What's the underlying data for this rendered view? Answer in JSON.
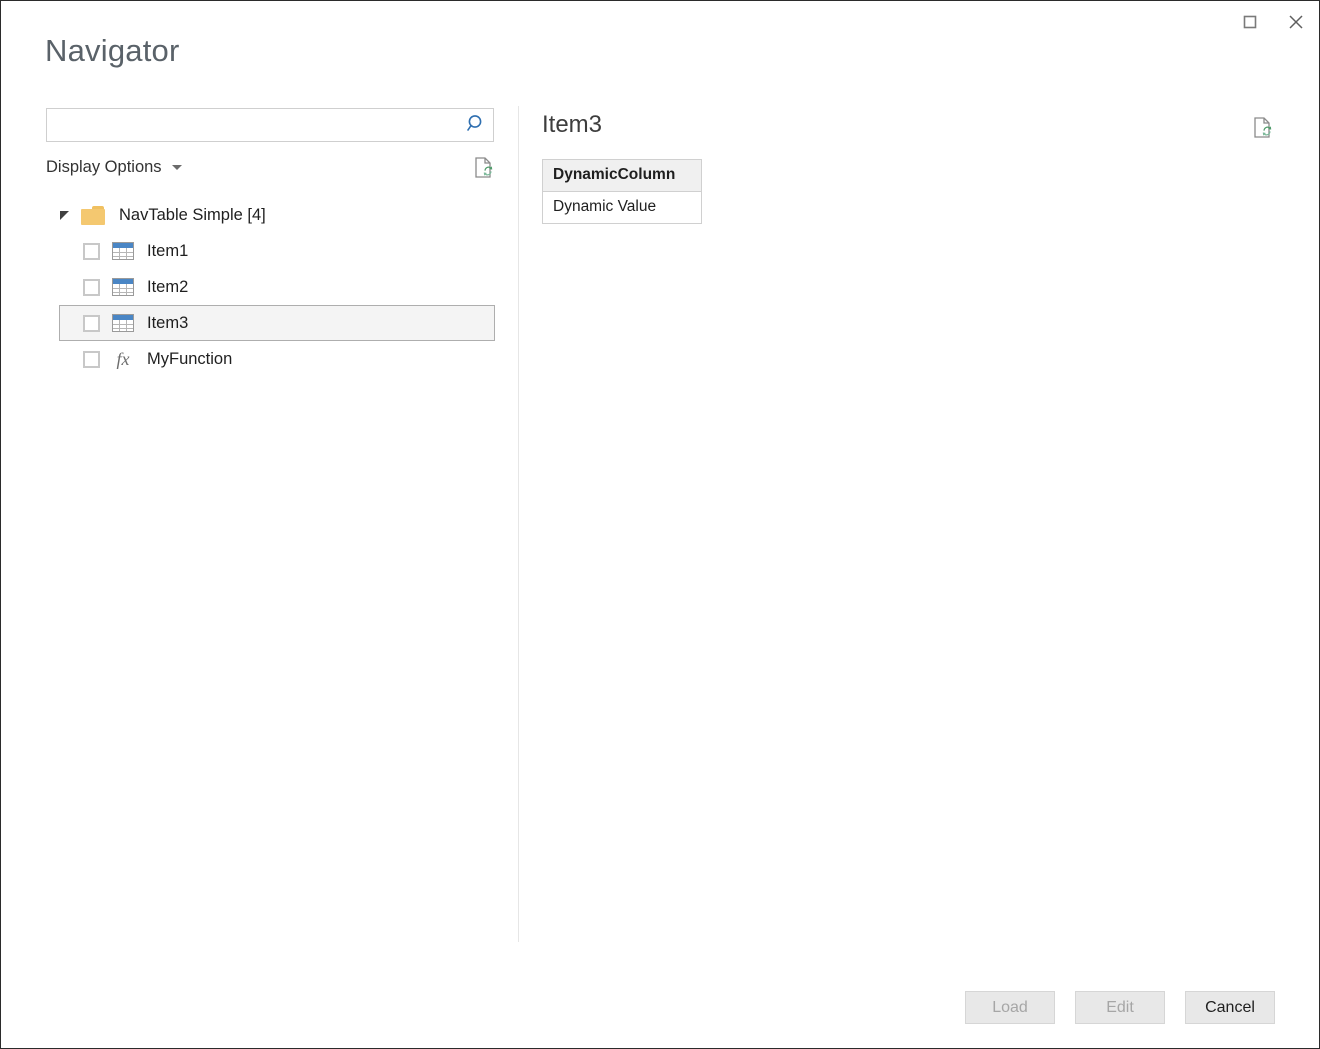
{
  "window": {
    "title": "Navigator",
    "controls": [
      {
        "name": "maximize-button",
        "icon": "maximize-icon",
        "label": ""
      },
      {
        "name": "close-button",
        "icon": "close-icon",
        "label": ""
      }
    ]
  },
  "left_pane": {
    "search": {
      "value": "",
      "placeholder": "",
      "icon": "search-icon"
    },
    "display_options": {
      "label": "Display Options",
      "caret_icon": "chevron-down-icon"
    },
    "refresh": {
      "icon": "refresh-document-icon",
      "tooltip": "Refresh"
    },
    "tree": {
      "root": {
        "label": "NavTable Simple [4]",
        "icon": "folder-icon",
        "expanded": true,
        "twisty_icon": "triangle-expanded-icon"
      },
      "items": [
        {
          "label": "Item1",
          "icon": "table-icon",
          "checked": false,
          "selected": false
        },
        {
          "label": "Item2",
          "icon": "table-icon",
          "checked": false,
          "selected": false
        },
        {
          "label": "Item3",
          "icon": "table-icon",
          "checked": false,
          "selected": true
        },
        {
          "label": "MyFunction",
          "icon": "fx-icon",
          "checked": false,
          "selected": false
        }
      ]
    }
  },
  "preview": {
    "title": "Item3",
    "refresh": {
      "icon": "refresh-document-icon",
      "tooltip": "Refresh"
    },
    "table": {
      "columns": [
        "DynamicColumn"
      ],
      "rows": [
        [
          "Dynamic Value"
        ]
      ]
    }
  },
  "footer": {
    "buttons": [
      {
        "name": "load-button",
        "label": "Load",
        "disabled": true
      },
      {
        "name": "edit-button",
        "label": "Edit",
        "disabled": true
      },
      {
        "name": "cancel-button",
        "label": "Cancel",
        "disabled": false
      }
    ]
  },
  "colors": {
    "title_text": "#5a6269",
    "accent_blue": "#2f6fb0",
    "folder_yellow": "#f4c870",
    "table_header_blue": "#4a86c5",
    "refresh_green": "#6aa84f",
    "selection_fill": "#f4f4f4",
    "selection_border": "#aeaeae",
    "border_gray": "#cfcfcf"
  }
}
